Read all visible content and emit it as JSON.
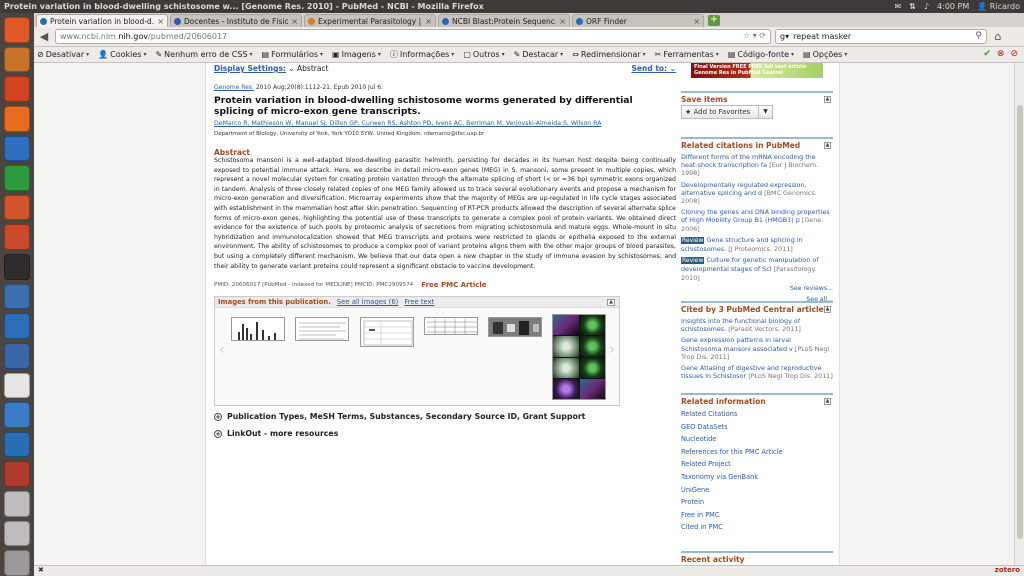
{
  "os": {
    "window_title": "Protein variation in blood-dwelling schistosome w... [Genome Res. 2010] - PubMed - NCBI - Mozilla Firefox",
    "time": "4:00 PM",
    "user": "Ricardo"
  },
  "launcher": {
    "items": [
      "ubuntu-icon",
      "files-icon",
      "flame-icon",
      "firefox-icon",
      "writer-icon",
      "calc-icon",
      "impress-icon",
      "settings-icon",
      "terminal-icon",
      "cube-icon",
      "thunderbird-icon",
      "scientist-icon",
      "editor-icon",
      "chromium-icon",
      "xcode-icon",
      "viewer-icon",
      "drive-icon",
      "drive-icon",
      "trash-icon"
    ],
    "colors": [
      "#e05a28",
      "#c8722a",
      "#d1421f",
      "#e86a1e",
      "#2f6fbf",
      "#2f9a3c",
      "#d1552a",
      "#c84a2a",
      "#2e2e2e",
      "#3a6fb0",
      "#2d6fb7",
      "#3a66a8",
      "#e6e6e6",
      "#3b7cc9",
      "#2a6db5",
      "#b03a2e",
      "#bdbdbd",
      "#bdbdbd",
      "#9a9a9a"
    ]
  },
  "tabs": [
    {
      "label": "Protein variation in blood-d...",
      "active": true,
      "color": "#2b6bb0"
    },
    {
      "label": "Docentes - Instituto de Físic...",
      "active": false,
      "color": "#3058a6"
    },
    {
      "label": "Experimental Parasitology |...",
      "active": false,
      "color": "#e07a1a"
    },
    {
      "label": "NCBI Blast:Protein Sequenc...",
      "active": false,
      "color": "#2b6bb0"
    },
    {
      "label": "ORF Finder",
      "active": false,
      "color": "#2b6bb0"
    }
  ],
  "nav": {
    "url_prefix": "www.ncbi.nlm.",
    "url_domain": "nih.gov",
    "url_path": "/pubmed/20606017",
    "search_value": "repeat masker"
  },
  "webdev": {
    "items": [
      {
        "icon": "⊘",
        "label": "Desativar"
      },
      {
        "icon": "👤",
        "label": "Cookies"
      },
      {
        "icon": "✎",
        "label": "Nenhum erro de CSS"
      },
      {
        "icon": "▤",
        "label": "Formulários"
      },
      {
        "icon": "▣",
        "label": "Imagens"
      },
      {
        "icon": "ⓘ",
        "label": "Informações"
      },
      {
        "icon": "▢",
        "label": "Outros"
      },
      {
        "icon": "✎",
        "label": "Destacar"
      },
      {
        "icon": "⇔",
        "label": "Redimensionar"
      },
      {
        "icon": "✂",
        "label": "Ferramentas"
      },
      {
        "icon": "▤",
        "label": "Código-fonte"
      },
      {
        "icon": "▤",
        "label": "Opções"
      }
    ]
  },
  "article": {
    "display_settings_label": "Display Settings:",
    "display_format": "Abstract",
    "send_to": "Send to:",
    "journal": "Genome Res.",
    "citation": "2010 Aug;20(8):1112-21. Epub 2010 Jul 6.",
    "title": "Protein variation in blood-dwelling schistosome worms generated by differential splicing of micro-exon gene transcripts.",
    "authors": [
      "DeMarco R",
      "Mathieson W",
      "Manuel SJ",
      "Dillon GP",
      "Curwen RS",
      "Ashton PD",
      "Ivens AC",
      "Berriman M",
      "Verjovski-Almeida S",
      "Wilson RA"
    ],
    "affiliation": "Department of Biology, University of York, York YO10 5YW, United Kingdom. rdemarco@ifsc.usp.br",
    "abstract_heading": "Abstract",
    "abstract": "Schistosoma mansoni is a well-adapted blood-dwelling parasitic helminth, persisting for decades in its human host despite being continually exposed to potential immune attack. Here, we describe in detail micro-exon genes (MEG) in S. mansoni, some present in multiple copies, which represent a novel molecular system for creating protein variation through the alternate splicing of short (< or =36 bp) symmetric exons organized in tandem. Analysis of three closely related copies of one MEG family allowed us to trace several evolutionary events and propose a mechanism for micro-exon generation and diversification. Microarray experiments show that the majority of MEGs are up-regulated in life cycle stages associated with establishment in the mammalian host after skin penetration. Sequencing of RT-PCR products allowed the description of several alternate splice forms of micro-exon genes, highlighting the potential use of these transcripts to generate a complex pool of protein variants. We obtained direct evidence for the existence of such pools by proteomic analysis of secretions from migrating schistosomula and mature eggs. Whole-mount in situ hybridization and immunolocalization showed that MEG transcripts and proteins were restricted to glands or epithelia exposed to the external environment. The ability of schistosomes to produce a complex pool of variant proteins aligns them with the other major groups of blood parasites, but using a completely different mechanism. We believe that our data open a new chapter in the study of immune evasion by schistosomes, and their ability to generate variant proteins could represent a significant obstacle to vaccine development.",
    "pmid_line": "PMID: 20606017 [PubMed - indexed for MEDLINE]    PMCID: PMC2909574",
    "free_pmc": "Free PMC Article",
    "images_heading": "Images from this publication.",
    "see_all_images": "See all images (6)",
    "free_text": "Free text",
    "pub_types": "Publication Types, MeSH Terms, Substances, Secondary Source ID, Grant Support",
    "linkout": "LinkOut - more resources"
  },
  "sidebar": {
    "banner_line1": "Final Version FREE",
    "banner_line2": "FREE full text article",
    "banner_line3": "in PubMed Central",
    "banner_line4": "Genome Res",
    "save_items": "Save items",
    "add_to_favorites": "Add to Favorites",
    "related_heading": "Related citations in PubMed",
    "related": [
      {
        "title": "Different forms of the mRNA encoding the heat-shock transcription fa",
        "source": "[Eur J Biochem. 1998]",
        "review": ""
      },
      {
        "title": "Developmentally regulated expression, alternative splicing and d",
        "source": "[BMC Genomics. 2008]",
        "review": ""
      },
      {
        "title": "Cloning the genes and DNA binding properties of High Mobility Group B1 (HMGB1) p",
        "source": "[Gene. 2006]",
        "review": ""
      },
      {
        "title": "Gene structure and splicing in schistosomes.",
        "source": "[J Proteomics. 2011]",
        "review": "Review"
      },
      {
        "title": "Culture for genetic manipulation of developmental stages of Scl",
        "source": "[Parasitology. 2010]",
        "review": "Review"
      }
    ],
    "see_reviews": "See reviews...",
    "see_all": "See all...",
    "cited_heading": "Cited by 3 PubMed Central articles",
    "cited": [
      {
        "title": "Insights into the functional biology of schistosomes.",
        "source": "[Parasit Vectors. 2011]"
      },
      {
        "title": "Gene expression patterns in larval Schistosoma mansoni associated v",
        "source": "[PLoS Negl Trop Dis. 2011]"
      },
      {
        "title": "Gene Atlasing of digestive and reproductive tissues in Schistosor",
        "source": "[PLoS Negl Trop Dis. 2011]"
      }
    ],
    "relinfo_heading": "Related information",
    "relinfo": [
      "Related Citations",
      "GEO DataSets",
      "Nucleotide",
      "References for this PMC Article",
      "Related Project",
      "Taxonomy via GenBank",
      "UniGene",
      "Protein",
      "Free in PMC",
      "Cited in PMC"
    ],
    "recent_activity": "Recent activity"
  },
  "status": {
    "zotero": "zotero"
  }
}
